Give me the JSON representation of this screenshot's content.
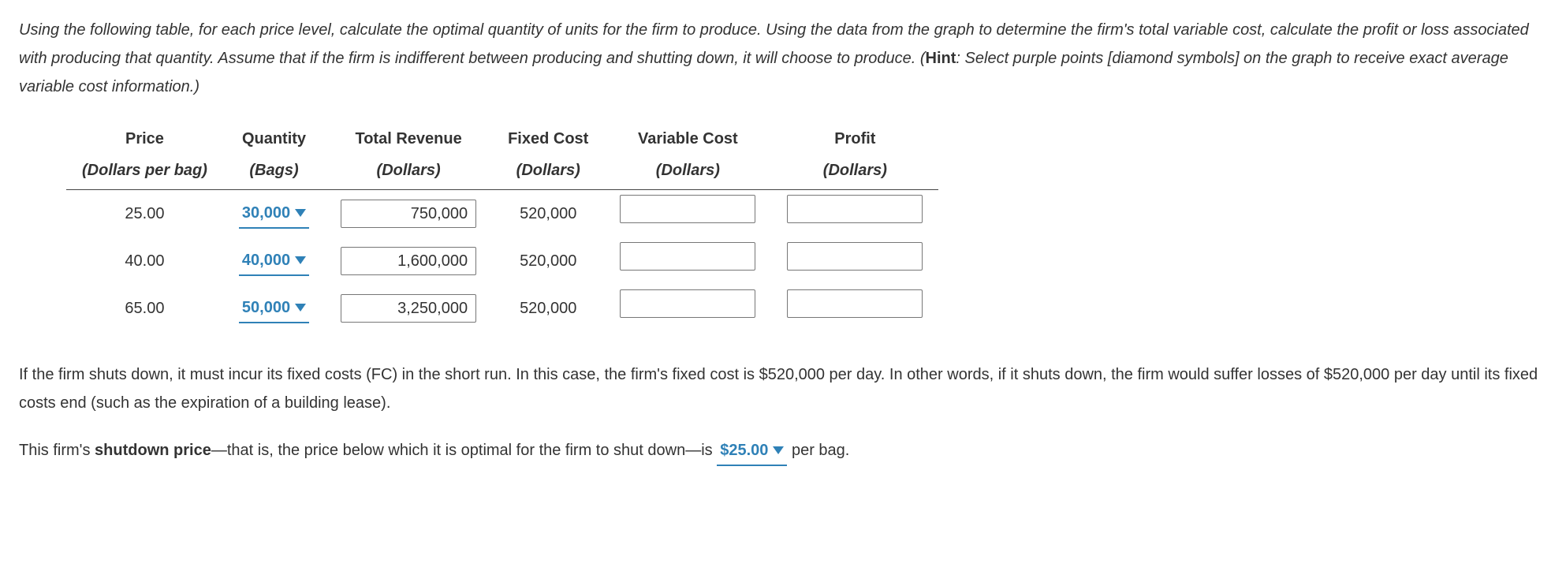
{
  "intro": {
    "p1a": "Using the following table, for each price level, calculate the optimal quantity of units for the firm to produce. Using the data from the graph to determine the firm's total variable cost, calculate the profit or loss associated with producing that quantity. Assume that if the firm is indifferent between producing and shutting down, it will choose to produce. (",
    "hint_label": "Hint",
    "p1b": ": Select purple points [diamond symbols] on the graph to receive exact average variable cost information.)"
  },
  "table": {
    "headers": {
      "price": "Price",
      "quantity": "Quantity",
      "total_revenue": "Total Revenue",
      "fixed_cost": "Fixed Cost",
      "variable_cost": "Variable Cost",
      "profit": "Profit"
    },
    "subheaders": {
      "price": "(Dollars per bag)",
      "quantity": "(Bags)",
      "total_revenue": "(Dollars)",
      "fixed_cost": "(Dollars)",
      "variable_cost": "(Dollars)",
      "profit": "(Dollars)"
    },
    "rows": [
      {
        "price": "25.00",
        "quantity": "30,000",
        "total_revenue": "750,000",
        "fixed_cost": "520,000",
        "variable_cost": "",
        "profit": ""
      },
      {
        "price": "40.00",
        "quantity": "40,000",
        "total_revenue": "1,600,000",
        "fixed_cost": "520,000",
        "variable_cost": "",
        "profit": ""
      },
      {
        "price": "65.00",
        "quantity": "50,000",
        "total_revenue": "3,250,000",
        "fixed_cost": "520,000",
        "variable_cost": "",
        "profit": ""
      }
    ]
  },
  "para2": "If the firm shuts down, it must incur its fixed costs (FC) in the short run. In this case, the firm's fixed cost is $520,000 per day. In other words, if it shuts down, the firm would suffer losses of $520,000 per day until its fixed costs end (such as the expiration of a building lease).",
  "para3": {
    "pre": "This firm's ",
    "bold": "shutdown price",
    "mid": "—that is, the price below which it is optimal for the firm to shut down—is ",
    "value": "$25.00",
    "post": " per bag."
  }
}
